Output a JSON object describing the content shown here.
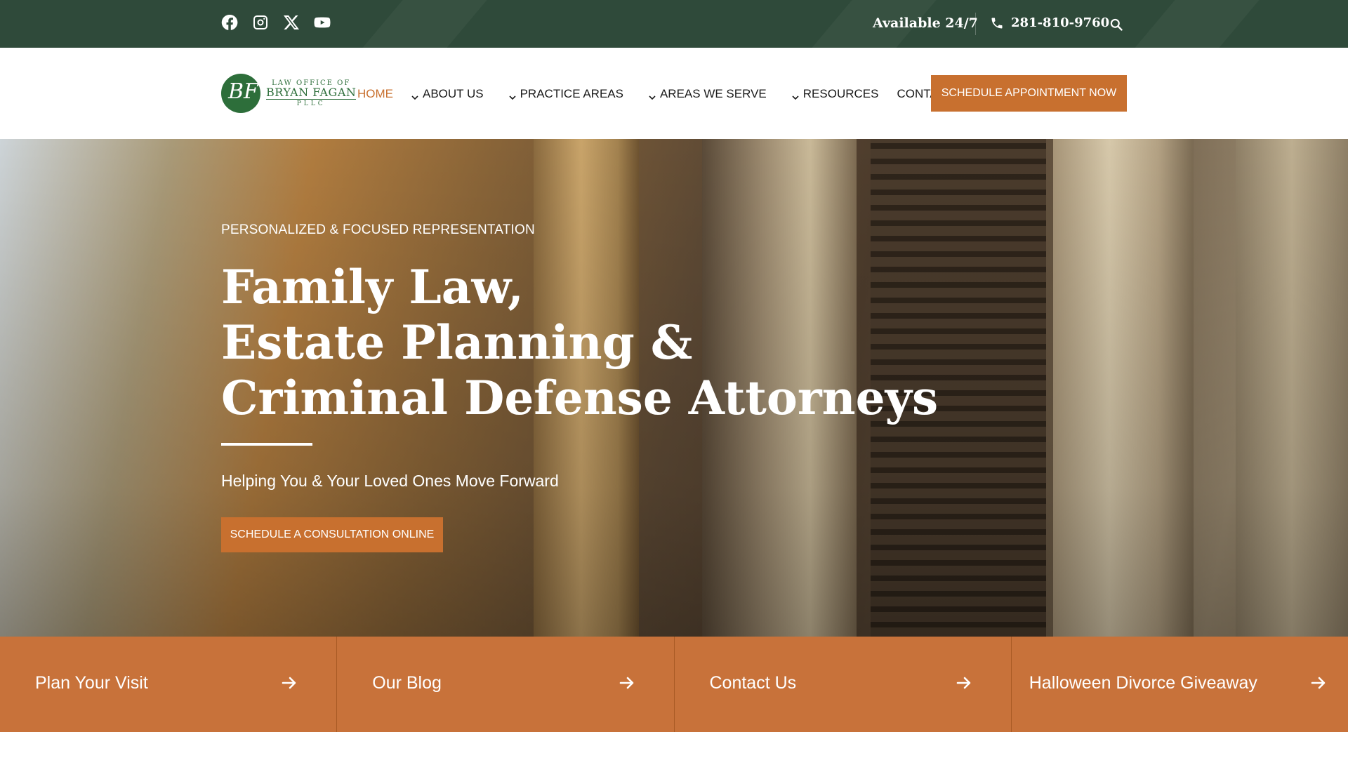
{
  "topbar": {
    "social_icons": [
      "facebook-icon",
      "instagram-icon",
      "x-icon",
      "youtube-icon"
    ],
    "availability": "Available 24/7",
    "phone": "281-810-9760",
    "search_icon": "search-icon"
  },
  "logo": {
    "line1": "LAW OFFICE OF",
    "line2": "BRYAN FAGAN",
    "line3": "PLLC",
    "monogram": "BF"
  },
  "nav": {
    "items": [
      {
        "label": "HOME",
        "dropdown": false,
        "active": true
      },
      {
        "label": "ABOUT US",
        "dropdown": true,
        "active": false
      },
      {
        "label": "PRACTICE AREAS",
        "dropdown": true,
        "active": false
      },
      {
        "label": "AREAS WE SERVE",
        "dropdown": true,
        "active": false
      },
      {
        "label": "RESOURCES",
        "dropdown": true,
        "active": false
      },
      {
        "label": "CONTACT",
        "dropdown": false,
        "active": false
      }
    ],
    "cta": "SCHEDULE APPOINTMENT NOW"
  },
  "hero": {
    "eyebrow": "PERSONALIZED & FOCUSED REPRESENTATION",
    "headline": [
      "Family Law,",
      "Estate Planning &",
      "Criminal Defense Attorneys"
    ],
    "subheading": "Helping You & Your Loved Ones Move Forward",
    "cta": "SCHEDULE A CONSULTATION ONLINE"
  },
  "tiles": [
    {
      "label": "Plan Your Visit"
    },
    {
      "label": "Our Blog"
    },
    {
      "label": "Contact Us"
    },
    {
      "label": "Halloween Divorce Giveaway"
    }
  ],
  "colors": {
    "topbar": "#2f4a3a",
    "accent": "#c8702f",
    "brand_green": "#2d6e3a"
  }
}
